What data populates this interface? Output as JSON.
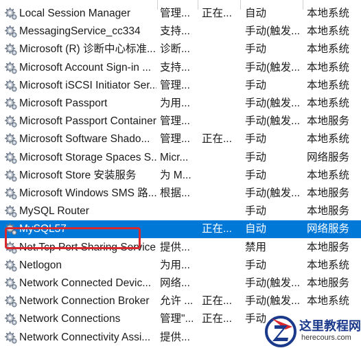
{
  "services": {
    "rows": [
      {
        "name": "Local Session Manager",
        "description": "管理...",
        "status": "正在...",
        "startup": "自动",
        "logon": "本地系统",
        "icon": "gear-icon"
      },
      {
        "name": "MessagingService_cc334",
        "description": "支持...",
        "status": "",
        "startup": "手动(触发...",
        "logon": "本地系统",
        "icon": "gear-icon"
      },
      {
        "name": "Microsoft (R) 诊断中心标准...",
        "description": "诊断...",
        "status": "",
        "startup": "手动",
        "logon": "本地系统",
        "icon": "gear-icon"
      },
      {
        "name": "Microsoft Account Sign-in ...",
        "description": "支持...",
        "status": "",
        "startup": "手动(触发...",
        "logon": "本地系统",
        "icon": "gear-icon"
      },
      {
        "name": "Microsoft iSCSI Initiator Ser...",
        "description": "管理...",
        "status": "",
        "startup": "手动",
        "logon": "本地系统",
        "icon": "gear-icon"
      },
      {
        "name": "Microsoft Passport",
        "description": "为用...",
        "status": "",
        "startup": "手动(触发...",
        "logon": "本地系统",
        "icon": "gear-icon"
      },
      {
        "name": "Microsoft Passport Container",
        "description": "管理...",
        "status": "",
        "startup": "手动(触发...",
        "logon": "本地服务",
        "icon": "gear-icon"
      },
      {
        "name": "Microsoft Software Shado...",
        "description": "管理...",
        "status": "正在...",
        "startup": "手动",
        "logon": "本地系统",
        "icon": "gear-icon"
      },
      {
        "name": "Microsoft Storage Spaces S...",
        "description": "Micr...",
        "status": "",
        "startup": "手动",
        "logon": "网络服务",
        "icon": "gear-icon"
      },
      {
        "name": "Microsoft Store 安装服务",
        "description": "为 M...",
        "status": "",
        "startup": "手动",
        "logon": "本地系统",
        "icon": "gear-icon"
      },
      {
        "name": "Microsoft Windows SMS 路...",
        "description": "根据...",
        "status": "",
        "startup": "手动(触发...",
        "logon": "本地服务",
        "icon": "gear-icon"
      },
      {
        "name": "MySQL Router",
        "description": "",
        "status": "",
        "startup": "手动",
        "logon": "本地服务",
        "icon": "gear-icon"
      },
      {
        "name": "MySQL57",
        "description": "",
        "status": "正在...",
        "startup": "自动",
        "logon": "网络服务",
        "icon": "gear-icon"
      },
      {
        "name": "Net.Tcp Port Sharing Service",
        "description": "提供...",
        "status": "",
        "startup": "禁用",
        "logon": "本地服务",
        "icon": "gear-icon"
      },
      {
        "name": "Netlogon",
        "description": "为用...",
        "status": "",
        "startup": "手动",
        "logon": "本地系统",
        "icon": "gear-icon"
      },
      {
        "name": "Network Connected Devic...",
        "description": "网络...",
        "status": "",
        "startup": "手动(触发...",
        "logon": "本地服务",
        "icon": "gear-icon"
      },
      {
        "name": "Network Connection Broker",
        "description": "允许 ...",
        "status": "正在...",
        "startup": "手动(触发...",
        "logon": "本地系统",
        "icon": "gear-icon"
      },
      {
        "name": "Network Connections",
        "description": "管理\"...",
        "status": "正在...",
        "startup": "手动",
        "logon": "",
        "icon": "gear-icon"
      },
      {
        "name": "Network Connectivity Assi...",
        "description": "提供...",
        "status": "",
        "startup": "",
        "logon": "",
        "icon": "gear-icon"
      }
    ],
    "selected_row": 12,
    "colors": {
      "selection": "#0078d7",
      "highlight_box": "#d9272e",
      "text": "#1a1a1a"
    }
  },
  "watermark": {
    "title": "这里教程网",
    "url": "herecours.com",
    "logo_icon": "z-logo-icon"
  }
}
